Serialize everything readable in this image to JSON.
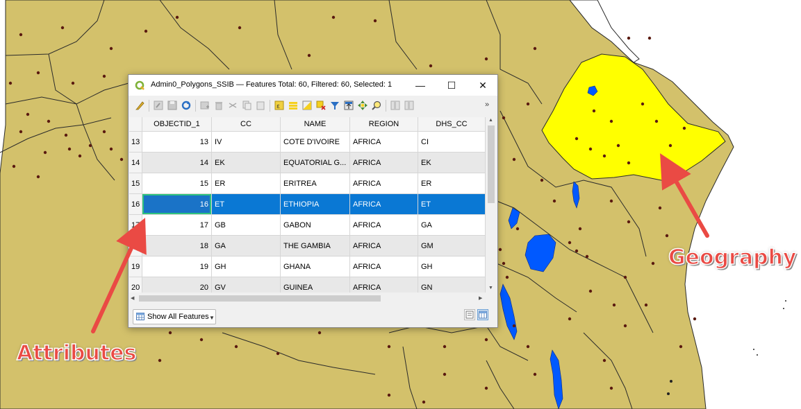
{
  "window": {
    "title": "Admin0_Polygons_SSIB — Features Total: 60, Filtered: 60, Selected: 1",
    "minimize_glyph": "—",
    "maximize_glyph": "☐",
    "close_glyph": "✕"
  },
  "toolbar": {
    "icons": [
      "toggle-editing-icon",
      "multi-edit-icon",
      "save-edits-icon",
      "reload-icon",
      "add-feature-icon",
      "delete-feature-icon",
      "cut-icon",
      "copy-icon",
      "paste-icon",
      "expression-select-icon",
      "select-all-icon",
      "invert-selection-icon",
      "deselect-all-icon",
      "filter-icon",
      "move-selection-top-icon",
      "pan-to-selection-icon",
      "zoom-to-selection-icon",
      "new-field-icon",
      "delete-field-icon",
      "field-calculator-icon"
    ],
    "more_label": "»"
  },
  "table": {
    "columns": [
      "OBJECTID_1",
      "CC",
      "NAME",
      "REGION",
      "DHS_CC"
    ],
    "rows": [
      {
        "row": "13",
        "objectid": "13",
        "cc": "IV",
        "name": "COTE D'IVOIRE",
        "region": "AFRICA",
        "dhs_cc": "CI",
        "selected": false
      },
      {
        "row": "14",
        "objectid": "14",
        "cc": "EK",
        "name": "EQUATORIAL G...",
        "region": "AFRICA",
        "dhs_cc": "EK",
        "selected": false
      },
      {
        "row": "15",
        "objectid": "15",
        "cc": "ER",
        "name": "ERITREA",
        "region": "AFRICA",
        "dhs_cc": "ER",
        "selected": false
      },
      {
        "row": "16",
        "objectid": "16",
        "cc": "ET",
        "name": "ETHIOPIA",
        "region": "AFRICA",
        "dhs_cc": "ET",
        "selected": true
      },
      {
        "row": "17",
        "objectid": "17",
        "cc": "GB",
        "name": "GABON",
        "region": "AFRICA",
        "dhs_cc": "GA",
        "selected": false
      },
      {
        "row": "18",
        "objectid": "18",
        "cc": "GA",
        "name": "THE GAMBIA",
        "region": "AFRICA",
        "dhs_cc": "GM",
        "selected": false
      },
      {
        "row": "19",
        "objectid": "19",
        "cc": "GH",
        "name": "GHANA",
        "region": "AFRICA",
        "dhs_cc": "GH",
        "selected": false
      },
      {
        "row": "20",
        "objectid": "20",
        "cc": "GV",
        "name": "GUINEA",
        "region": "AFRICA",
        "dhs_cc": "GN",
        "selected": false
      }
    ]
  },
  "bottom": {
    "filter_label": "Show All Features",
    "view_modes": [
      "form-view-icon",
      "table-view-icon"
    ]
  },
  "annotations": {
    "attributes": "Attributes",
    "geography": "Geography"
  },
  "colors": {
    "map_land": "#d3c16b",
    "highlight": "#ffff00",
    "water": "#0059ff",
    "selection": "#0a78d4",
    "callout": "#ea4a44"
  }
}
